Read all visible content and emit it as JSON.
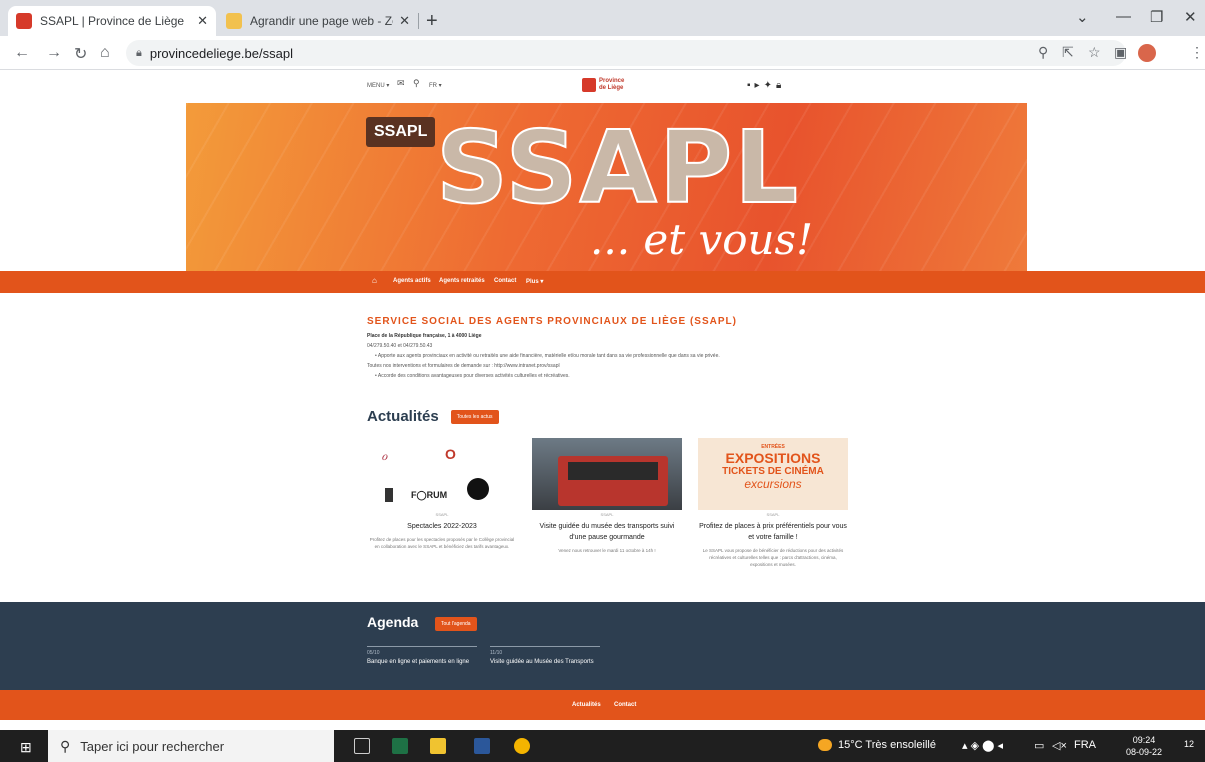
{
  "browser": {
    "tabs": [
      {
        "title": "SSAPL | Province de Liège",
        "active": true
      },
      {
        "title": "Agrandir une page web - Zoomer",
        "active": false
      }
    ],
    "url": "provincedeliege.be/ssapl"
  },
  "site": {
    "topnav": {
      "menu": "MENU",
      "lang": "FR"
    },
    "logo": {
      "line1": "Province",
      "line2": "de Liège"
    },
    "hero": {
      "badge": "SSAPL",
      "title": "SSAPL",
      "subtitle": "... et vous!"
    },
    "mainnav": [
      "Agents actifs",
      "Agents retraités",
      "Contact",
      "Plus"
    ],
    "intro": {
      "heading": "SERVICE SOCIAL DES AGENTS PROVINCIAUX DE LIÈGE (SSAPL)",
      "address": "Place de la République française, 1 à 4000 Liège",
      "phone": "04/279.50.40 et 04/279.50.43",
      "bullet1": "Apporte aux agents provinciaux en activité ou retraités une aide financière, matérielle et/ou morale tant dans sa vie professionnelle que dans sa vie privée.",
      "line2": "Toutes nos interventions et formulaires de demande sur : http://www.intranet.prov/ssapl",
      "bullet2": "Accorde des conditions avantageuses pour diverses activités culturelles et récréatives."
    },
    "news": {
      "title": "Actualités",
      "button": "Toutes les actus",
      "cards": [
        {
          "cat": "SSAPL",
          "title": "Spectacles 2022-2023",
          "desc": "Profitez de places pour les spectacles proposés par le Collège provincial en collaboration avec le SSAPL et bénéficiez des tarifs avantageux."
        },
        {
          "cat": "SSAPL",
          "title": "Visite guidée du musée des transports suivi d'une pause gourmande",
          "desc": "Venez nous retrouver le mardi 11 octobre à 14h !"
        },
        {
          "cat": "SSAPL",
          "title": "Profitez de places à prix préférentiels pour vous et votre famille !",
          "desc": "Le SSAPL vous propose de bénéficier de réductions pour des activités récréatives et culturelles telles que : parcs d'attractions, cinéma, expositions et musées."
        }
      ],
      "card3_image_text": [
        "ENTRÉES",
        "EXPOSITIONS",
        "TICKETS DE CINÉMA",
        "excursions"
      ]
    },
    "agenda": {
      "title": "Agenda",
      "button": "Tout l'agenda",
      "items": [
        {
          "date": "05/10",
          "event": "Banque en ligne et paiements en ligne"
        },
        {
          "date": "11/10",
          "event": "Visite guidée au Musée des Transports"
        }
      ]
    },
    "footer": [
      "Actualités",
      "Contact"
    ]
  },
  "taskbar": {
    "search_placeholder": "Taper ici pour rechercher",
    "weather": "15°C Très ensoleillé",
    "lang": "FRA",
    "time": "09:24",
    "date": "08-09-22",
    "notif": "12"
  }
}
